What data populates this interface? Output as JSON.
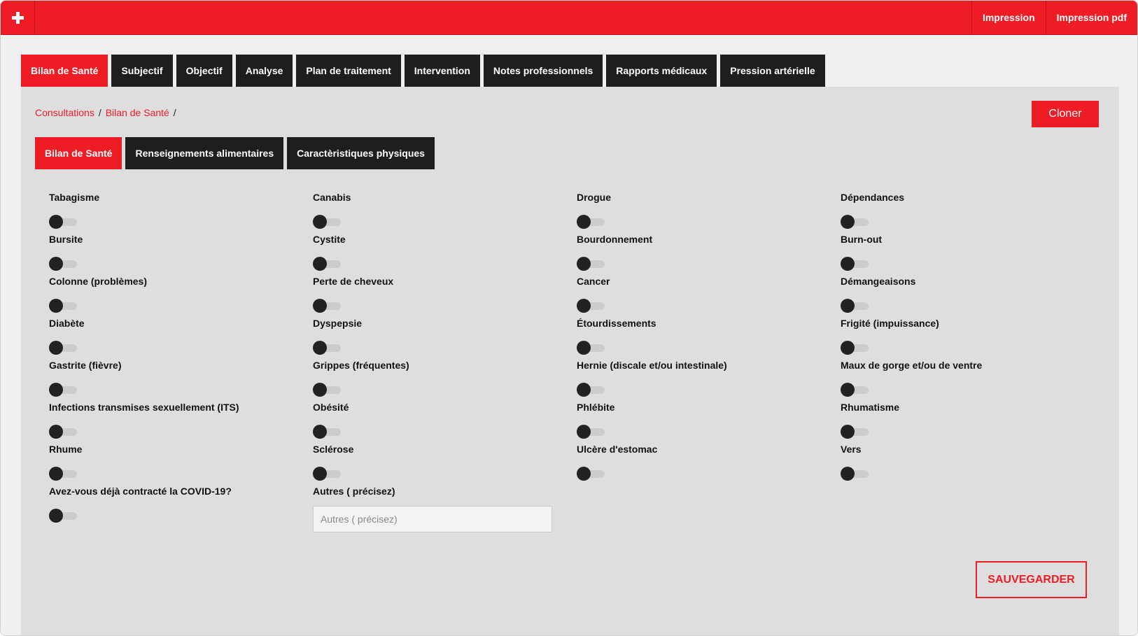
{
  "header": {
    "links": [
      {
        "label": "Impression"
      },
      {
        "label": "Impression pdf"
      }
    ]
  },
  "main_tabs": [
    {
      "label": "Bilan de Santé",
      "active": true
    },
    {
      "label": "Subjectif",
      "active": false
    },
    {
      "label": "Objectif",
      "active": false
    },
    {
      "label": "Analyse",
      "active": false
    },
    {
      "label": "Plan de traitement",
      "active": false
    },
    {
      "label": "Intervention",
      "active": false
    },
    {
      "label": "Notes professionnels",
      "active": false
    },
    {
      "label": "Rapports médicaux",
      "active": false
    },
    {
      "label": "Pression artérielle",
      "active": false
    }
  ],
  "breadcrumb": {
    "items": [
      "Consultations",
      "Bilan de Santé"
    ],
    "separator": "/"
  },
  "clone_label": "Cloner",
  "sub_tabs": [
    {
      "label": "Bilan de Santé",
      "active": true
    },
    {
      "label": "Renseignements alimentaires",
      "active": false
    },
    {
      "label": "Caractèristiques physiques",
      "active": false
    }
  ],
  "fields": [
    {
      "label": "Tabagisme",
      "checked": false
    },
    {
      "label": "Canabis",
      "checked": false
    },
    {
      "label": "Drogue",
      "checked": false
    },
    {
      "label": "Dépendances",
      "checked": false
    },
    {
      "label": "Bursite",
      "checked": false
    },
    {
      "label": "Cystite",
      "checked": false
    },
    {
      "label": "Bourdonnement",
      "checked": false
    },
    {
      "label": "Burn-out",
      "checked": false
    },
    {
      "label": "Colonne (problèmes)",
      "checked": false
    },
    {
      "label": "Perte de cheveux",
      "checked": false
    },
    {
      "label": "Cancer",
      "checked": false
    },
    {
      "label": "Démangeaisons",
      "checked": false
    },
    {
      "label": "Diabète",
      "checked": false
    },
    {
      "label": "Dyspepsie",
      "checked": false
    },
    {
      "label": "Étourdissements",
      "checked": false
    },
    {
      "label": "Frigité (impuissance)",
      "checked": false
    },
    {
      "label": "Gastrite (fièvre)",
      "checked": false
    },
    {
      "label": "Grippes (fréquentes)",
      "checked": false
    },
    {
      "label": "Hernie (discale et/ou intestinale)",
      "checked": false
    },
    {
      "label": "Maux de gorge et/ou de ventre",
      "checked": false
    },
    {
      "label": "Infections transmises sexuellement (ITS)",
      "checked": false
    },
    {
      "label": "Obésité",
      "checked": false
    },
    {
      "label": "Phlébite",
      "checked": false
    },
    {
      "label": "Rhumatisme",
      "checked": false
    },
    {
      "label": "Rhume",
      "checked": false
    },
    {
      "label": "Sclérose",
      "checked": false
    },
    {
      "label": "Ulcère d'estomac",
      "checked": false
    },
    {
      "label": "Vers",
      "checked": false
    },
    {
      "label": "Avez-vous déjà contracté la COVID-19?",
      "checked": false
    }
  ],
  "other": {
    "label": "Autres ( précisez)",
    "value": "",
    "placeholder": "Autres ( précisez)"
  },
  "save_label": "SAUVEGARDER",
  "colors": {
    "accent": "#ee1c25",
    "dark": "#1e1e1e",
    "panel": "#dedede"
  }
}
